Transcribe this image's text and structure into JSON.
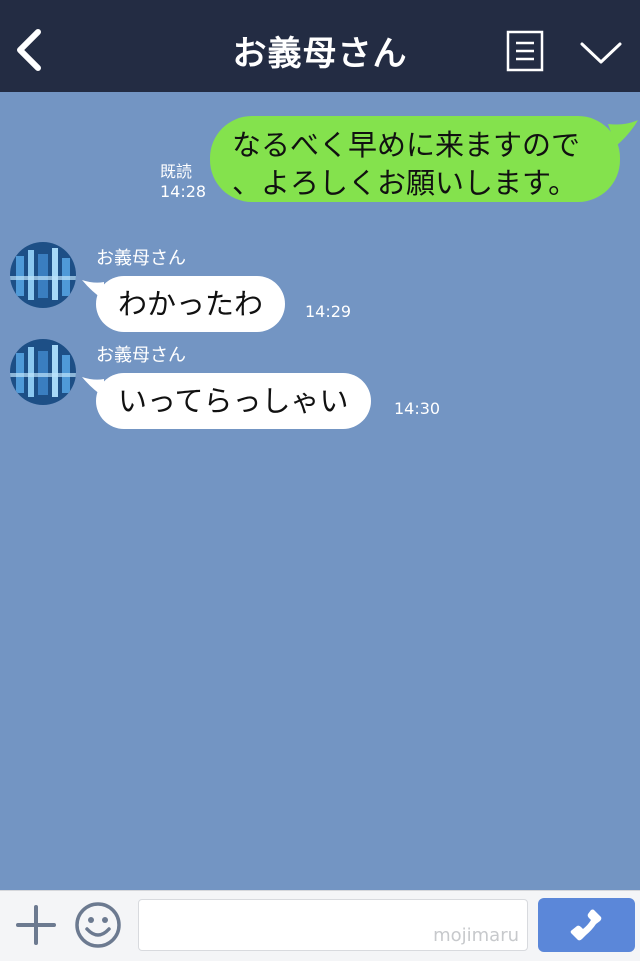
{
  "header": {
    "title": "お義母さん",
    "back_icon": "chevron-left-icon",
    "menu_icon": "memo-icon",
    "collapse_icon": "chevron-down-icon"
  },
  "messages": [
    {
      "direction": "out",
      "line1": "なるべく早めに来ますので",
      "line2": "、よろしくお願いします。",
      "read_label": "既読",
      "time": "14:28"
    },
    {
      "direction": "in",
      "sender": "お義母さん",
      "text": "わかったわ",
      "time": "14:29"
    },
    {
      "direction": "in",
      "sender": "お義母さん",
      "text": "いってらっしゃい",
      "time": "14:30"
    }
  ],
  "bottom_bar": {
    "plus_icon": "plus-icon",
    "emoji_icon": "smiley-icon",
    "input_watermark": "mojimaru",
    "call_icon": "phone-icon"
  },
  "colors": {
    "header": "#232c43",
    "background": "#7395c3",
    "outgoing_bubble": "#84e24d",
    "incoming_bubble": "#ffffff",
    "call_button": "#5b87d9"
  }
}
